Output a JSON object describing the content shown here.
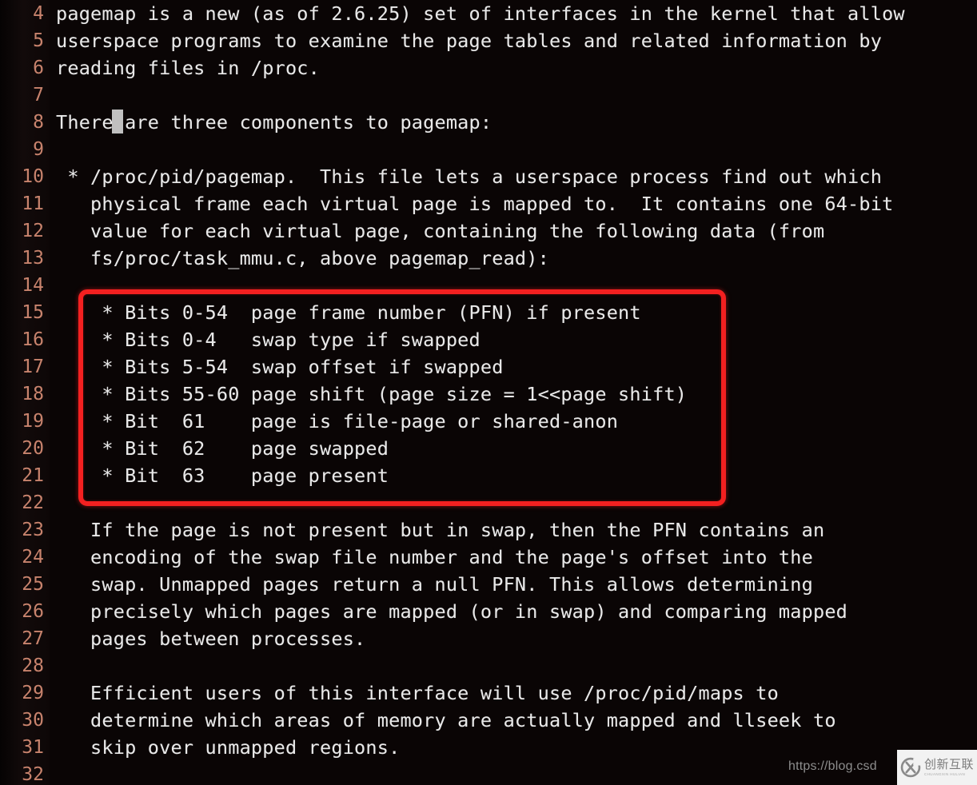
{
  "editor": {
    "background_color": "#0a0505",
    "text_color": "#e9e9e9",
    "lineno_color": "#c8836d",
    "cursor_color": "#d0d0d0",
    "first_line_number": 4,
    "lines": [
      {
        "number": "4",
        "text": "pagemap is a new (as of 2.6.25) set of interfaces in the kernel that allow"
      },
      {
        "number": "5",
        "text": "userspace programs to examine the page tables and related information by"
      },
      {
        "number": "6",
        "text": "reading files in /proc."
      },
      {
        "number": "7",
        "text": ""
      },
      {
        "number": "8",
        "text": "There are three components to pagemap:"
      },
      {
        "number": "9",
        "text": ""
      },
      {
        "number": "10",
        "text": " * /proc/pid/pagemap.  This file lets a userspace process find out which"
      },
      {
        "number": "11",
        "text": "   physical frame each virtual page is mapped to.  It contains one 64-bit"
      },
      {
        "number": "12",
        "text": "   value for each virtual page, containing the following data (from"
      },
      {
        "number": "13",
        "text": "   fs/proc/task_mmu.c, above pagemap_read):"
      },
      {
        "number": "14",
        "text": ""
      },
      {
        "number": "15",
        "text": "    * Bits 0-54  page frame number (PFN) if present"
      },
      {
        "number": "16",
        "text": "    * Bits 0-4   swap type if swapped"
      },
      {
        "number": "17",
        "text": "    * Bits 5-54  swap offset if swapped"
      },
      {
        "number": "18",
        "text": "    * Bits 55-60 page shift (page size = 1<<page shift)"
      },
      {
        "number": "19",
        "text": "    * Bit  61    page is file-page or shared-anon"
      },
      {
        "number": "20",
        "text": "    * Bit  62    page swapped"
      },
      {
        "number": "21",
        "text": "    * Bit  63    page present"
      },
      {
        "number": "22",
        "text": ""
      },
      {
        "number": "23",
        "text": "   If the page is not present but in swap, then the PFN contains an"
      },
      {
        "number": "24",
        "text": "   encoding of the swap file number and the page's offset into the"
      },
      {
        "number": "25",
        "text": "   swap. Unmapped pages return a null PFN. This allows determining"
      },
      {
        "number": "26",
        "text": "   precisely which pages are mapped (or in swap) and comparing mapped"
      },
      {
        "number": "27",
        "text": "   pages between processes."
      },
      {
        "number": "28",
        "text": ""
      },
      {
        "number": "29",
        "text": "   Efficient users of this interface will use /proc/pid/maps to"
      },
      {
        "number": "30",
        "text": "   determine which areas of memory are actually mapped and llseek to"
      },
      {
        "number": "31",
        "text": "   skip over unmapped regions."
      },
      {
        "number": "32",
        "text": ""
      }
    ]
  },
  "annotation": {
    "type": "rectangle",
    "color": "#f32020",
    "covers_lines": [
      "15",
      "16",
      "17",
      "18",
      "19",
      "20",
      "21"
    ],
    "description": "red highlight box around the pagemap bit-field table"
  },
  "watermark": {
    "url_text": "https://blog.csd",
    "logo_cn": "创新互联",
    "logo_sub": "CHUANGXIN HULIAN",
    "logo_mark": "circle-x-icon"
  }
}
